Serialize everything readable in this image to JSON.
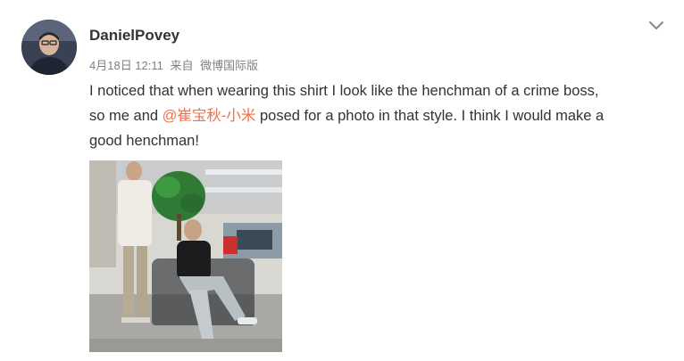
{
  "post": {
    "username": "DanielPovey",
    "date": "4月18日 12:11",
    "source_prefix": "来自",
    "source": "微博国际版",
    "text_line1": "I noticed that when wearing this shirt I look like the henchman of a crime boss,",
    "text_line2_before": "so me and ",
    "mention": "@崔宝秋-小米",
    "text_line2_after": " posed for a photo in that style.  I think I would make a",
    "text_line3": "good henchman!"
  },
  "colors": {
    "mention": "#eb7350",
    "username": "#333333",
    "meta": "#808080"
  },
  "icons": {
    "menu": "chevron-down-icon"
  }
}
